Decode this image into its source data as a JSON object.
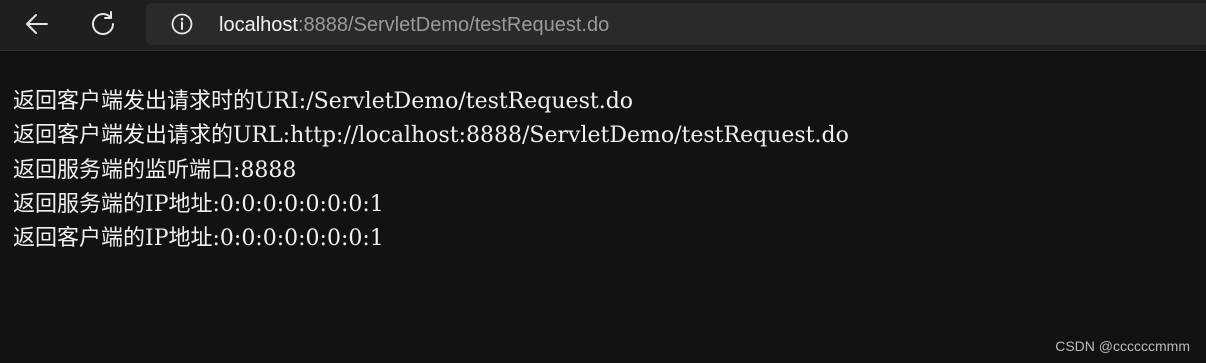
{
  "browser": {
    "back_icon": "back-arrow-icon",
    "reload_icon": "reload-icon",
    "info_icon": "info-icon",
    "url_host": "localhost",
    "url_rest": ":8888/ServletDemo/testRequest.do"
  },
  "page": {
    "lines": [
      "返回客户端发出请求时的URI:/ServletDemo/testRequest.do",
      "返回客户端发出请求的URL:http://localhost:8888/ServletDemo/testRequest.do",
      "返回服务端的监听端口:8888",
      "返回服务端的IP地址:0:0:0:0:0:0:0:1",
      "返回客户端的IP地址:0:0:0:0:0:0:0:1"
    ]
  },
  "watermark": "CSDN @ccccccmmm",
  "colors": {
    "background": "#121212",
    "toolbar": "#1f1f1f",
    "addressbar": "#2a2a2a",
    "text": "#f0f0f0"
  }
}
